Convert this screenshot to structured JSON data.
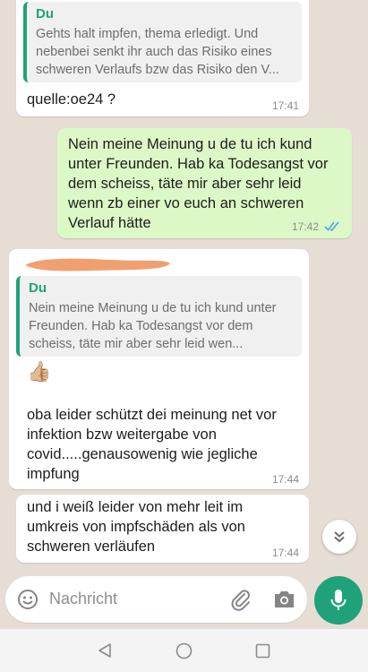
{
  "messages": [
    {
      "quote_author": "Du",
      "quote_text": "Gehts halt impfen, thema erledigt. Und nebenbei senkt ihr auch das Risiko eines schweren Verlaufs bzw das Risiko den V...",
      "text": "quelle:oe24 ?",
      "time": "17:41"
    },
    {
      "text": "Nein meine Meinung u de tu ich kund unter Freunden. Hab ka Todesangst vor dem scheiss, täte mir aber sehr leid wenn zb einer vo euch an schweren Verlauf hätte",
      "time": "17:42"
    },
    {
      "quote_author": "Du",
      "quote_text": "Nein meine Meinung u de tu ich kund unter Freunden. Hab ka Todesangst vor dem scheiss, täte mir aber sehr leid wen...",
      "emoji": "👍🏼",
      "text": "oba leider schützt dei meinung net vor infektion bzw weitergabe von covid.....genausowenig wie jegliche impfung",
      "time": "17:44"
    },
    {
      "text": "und i weiß leider von mehr leit im umkreis von impfschäden als von schweren verläufen",
      "time": "17:44"
    }
  ],
  "input": {
    "placeholder": "Nachricht"
  },
  "icons": {
    "read_receipt": "double-check-icon",
    "emoji": "smiley-icon",
    "attach": "paperclip-icon",
    "camera": "camera-icon",
    "mic": "microphone-icon",
    "scroll_down": "chevron-double-down-icon",
    "nav_back": "triangle-back-icon",
    "nav_home": "circle-home-icon",
    "nav_recents": "square-recents-icon"
  },
  "colors": {
    "background": "#e6ddd4",
    "incoming_bubble": "#ffffff",
    "outgoing_bubble": "#dcf8c6",
    "accent": "#1fa27a",
    "read_ticks": "#4fa3e0",
    "redaction": "#f0a070"
  }
}
